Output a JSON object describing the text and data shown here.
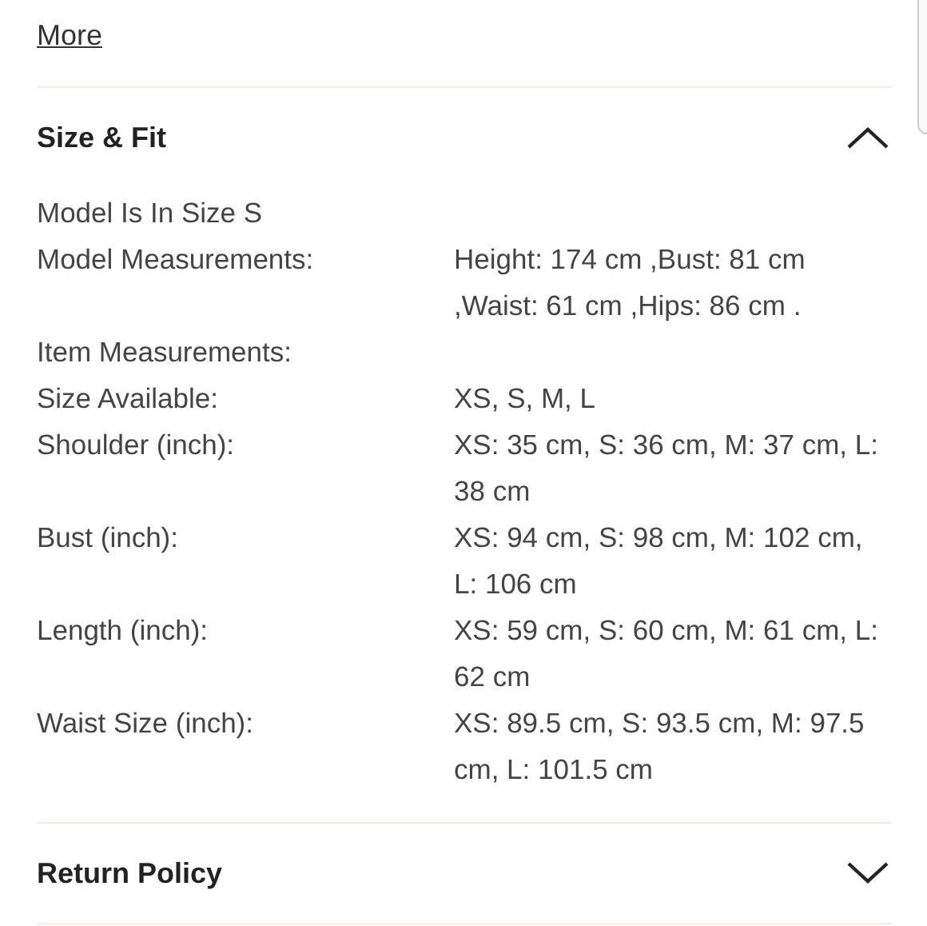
{
  "more_link": "More",
  "sections": [
    {
      "title": "Size & Fit",
      "expanded": true,
      "specs": [
        {
          "label": "Model Is In Size S"
        },
        {
          "label": "Model Measurements:",
          "value": "Height: 174 cm ,Bust: 81 cm ,Waist: 61 cm ,Hips: 86 cm ."
        },
        {
          "label": "Item Measurements:"
        },
        {
          "label": "Size Available:",
          "value": "XS, S, M, L"
        },
        {
          "label": "Shoulder (inch):",
          "value": "XS: 35 cm, S: 36 cm, M: 37 cm, L: 38 cm"
        },
        {
          "label": "Bust (inch):",
          "value": "XS: 94 cm, S: 98 cm, M: 102 cm, L: 106 cm"
        },
        {
          "label": "Length (inch):",
          "value": "XS: 59 cm, S: 60 cm, M: 61 cm, L: 62 cm"
        },
        {
          "label": "Waist Size (inch):",
          "value": "XS: 89.5 cm, S: 93.5 cm, M: 97.5 cm, L: 101.5 cm"
        }
      ]
    },
    {
      "title": "Return Policy",
      "expanded": false
    }
  ]
}
